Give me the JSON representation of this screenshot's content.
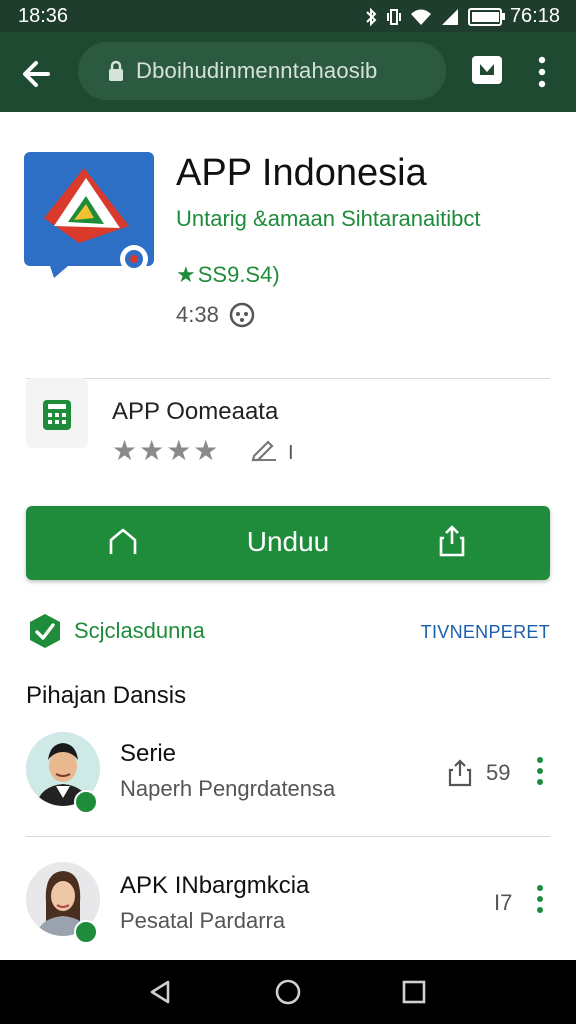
{
  "status_bar": {
    "time_left": "18:36",
    "time_right": "76:18",
    "icons": [
      "bluetooth-icon",
      "vibrate-icon",
      "wifi-icon",
      "signal-icon",
      "battery-icon"
    ],
    "battery_level": 0.9
  },
  "browser": {
    "url": "Dboihudinmenntahaosib",
    "icons": [
      "back-arrow-icon",
      "lock-icon",
      "tabs-icon",
      "overflow-menu-icon"
    ]
  },
  "app": {
    "title": "APP Indonesia",
    "subtitle": "Untarig &amaan Sihtaranaitibct",
    "rating_text": "SS9.S4)",
    "time": "4:38",
    "developer_name": "APP Oomeaata",
    "stars_shown": 4,
    "edit_text": "I",
    "install_label": "Unduu"
  },
  "section": {
    "verified_label": "Scjclasdunna",
    "more_link": "TIVNENPERET",
    "heading": "Pihajan Dansis"
  },
  "list": [
    {
      "title": "Serie",
      "subtitle": "Naperh Pengrdatensa",
      "count": "59"
    },
    {
      "title": "APK INbargmkcia",
      "subtitle": "Pesatal Pardarra",
      "count": "I7"
    }
  ],
  "colors": {
    "brand_green": "#1e8c3a",
    "toolbar": "#1f4a32",
    "status_bar": "#1f3d2c",
    "link_blue": "#1a5fb0"
  }
}
